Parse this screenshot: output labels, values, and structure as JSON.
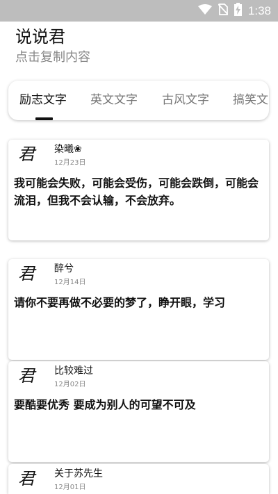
{
  "status_bar": {
    "time": "1:38",
    "icons": [
      "wifi-icon",
      "no-sim-icon",
      "battery-charging-icon"
    ]
  },
  "header": {
    "title": "说说君",
    "subtitle": "点击复制内容"
  },
  "tabs": [
    {
      "label": "励志文字",
      "active": true
    },
    {
      "label": "英文文字",
      "active": false
    },
    {
      "label": "古风文字",
      "active": false
    },
    {
      "label": "搞笑文字",
      "active": false
    }
  ],
  "posts": [
    {
      "avatar": "君",
      "author": "染曦❀",
      "date": "12月23日",
      "content": "我可能会失败，可能会受伤，可能会跌倒，可能会流泪，但我不会认输，不会放弃。"
    },
    {
      "avatar": "君",
      "author": "醉兮",
      "date": "12月14日",
      "content": "请你不要再做不必要的梦了，睁开眼，学习"
    },
    {
      "avatar": "君",
      "author": "比较难过",
      "date": "12月02日",
      "content": "要酷要优秀 要成为别人的可望不可及"
    },
    {
      "avatar": "君",
      "author": "关于苏先生",
      "date": "12月01日",
      "content": ""
    }
  ],
  "colors": {
    "status_bar": "#bdbdbd",
    "text_primary": "#111111",
    "text_secondary": "#888888",
    "tab_inactive": "#777777"
  }
}
